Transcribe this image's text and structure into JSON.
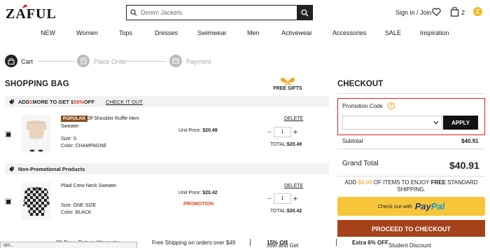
{
  "header": {
    "logo": "ZAFUL",
    "search_placeholder": "Denim Jackets",
    "signin": "Sign in / Join",
    "bag_count": "2",
    "coin": "Z"
  },
  "nav": [
    "NEW",
    "Women",
    "Tops",
    "Dresses",
    "Swimwear",
    "Men",
    "Activewear",
    "Accessories",
    "SALE",
    "Inspiration"
  ],
  "steps": [
    {
      "label": "Cart",
      "active": true
    },
    {
      "label": "Place Order",
      "active": false
    },
    {
      "label": "Payment",
      "active": false
    }
  ],
  "bag": {
    "title": "SHOPPING BAG",
    "free_gifts": "FREE GIFTS",
    "promo_bar": {
      "pre": "ADD ",
      "num": "1",
      "mid": " MORE TO GET 1 ",
      "pct": "50%",
      "post": " OFF",
      "link": "CHECK IT OUT"
    },
    "nonpromo_bar": "Non-Promotional Products",
    "items": [
      {
        "badge": "POPULAR",
        "name_line1": "Off Shoulder Ruffle Hem",
        "name_line2": "Sweater",
        "size": "Size: S",
        "color": "Color: CHAMPAGNE",
        "unit_label": "Unit Price:",
        "unit_price": "$20.49",
        "delete": "DELETE",
        "qty": "1",
        "total_label": "TOTAL:",
        "total": "$20.49",
        "promotion": ""
      },
      {
        "badge": "",
        "name_line1": "Plaid Crew Neck Sweater",
        "name_line2": "",
        "size": "Size: ONE SIZE",
        "color": "Color: BLACK",
        "unit_label": "Unit Price:",
        "unit_price": "$20.42",
        "delete": "DELETE",
        "qty": "1",
        "total_label": "TOTAL:",
        "total": "$20.42",
        "promotion": "PROMOTION"
      }
    ]
  },
  "checkout": {
    "title": "CHECKOUT",
    "promo_title": "Promotion Code",
    "promo_help": "?",
    "apply": "APPLY",
    "subtotal_label": "Subtotal",
    "subtotal": "$40.91",
    "grand_label": "Grand Total",
    "grand": "$40.91",
    "ship_pre": "ADD ",
    "ship_amount": "$8.09",
    "ship_mid": " OF ITEMS TO ENJOY ",
    "ship_bold": "FREE",
    "ship_post": " STANDARD SHIPPING.",
    "paypal_text": "Check out with",
    "paypal_brand_1": "Pay",
    "paypal_brand_2": "Pal",
    "proceed": "PROCEED TO CHECKOUT"
  },
  "footer": {
    "return": "30 Days Return Warranty",
    "free_ship": "Free Shipping on orders over $49",
    "join_pre": "Join and Get ",
    "join_bold": "15% Off",
    "extra_bold": "Extra 6% OFF",
    "extra_post": " Student Discount",
    "tooltip": "om..."
  },
  "colors": {
    "accent": "#a5421b",
    "promo_red": "#e0451f",
    "paypal_yellow": "#f7c53a",
    "highlight_box": "#e02020"
  }
}
